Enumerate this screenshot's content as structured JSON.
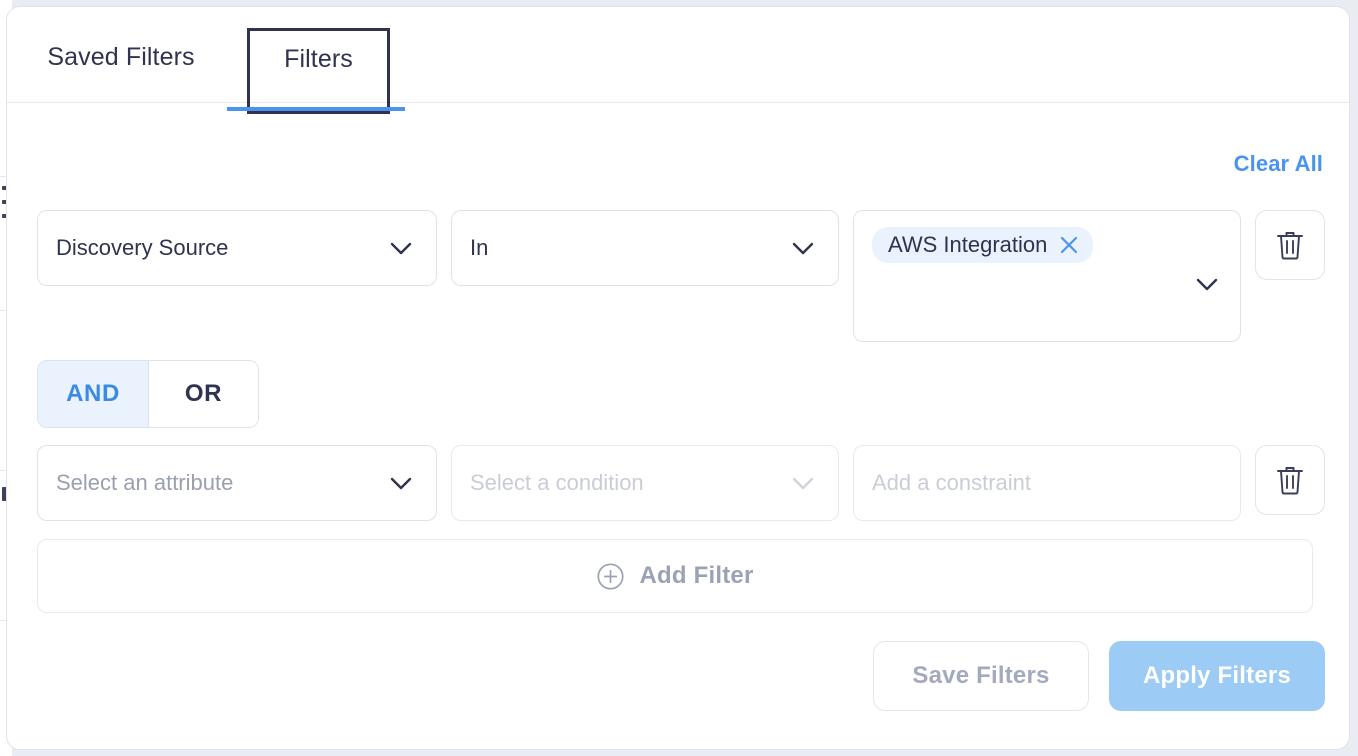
{
  "panel": {
    "tabs": [
      {
        "id": "saved-filters",
        "label": "Saved Filters",
        "selected": false
      },
      {
        "id": "filters",
        "label": "Filters",
        "selected": true,
        "focused": true
      }
    ],
    "clear_all_label": "Clear All",
    "accent_color": "#4a94ef",
    "text_color": "#2f3350",
    "placeholder_color": "#9aa0ae",
    "disabled_color": "#c9cdd6"
  },
  "filter_rows": [
    {
      "attribute": {
        "value": "Discovery Source",
        "is_placeholder": false,
        "icon": "chevron-down-icon"
      },
      "condition": {
        "value": "In",
        "is_placeholder": false,
        "icon": "chevron-down-icon"
      },
      "constraint": {
        "chips": [
          {
            "label": "AWS Integration",
            "remove_icon": "close-icon"
          }
        ],
        "icon": "chevron-down-icon"
      },
      "delete": {
        "icon": "trash-icon"
      }
    },
    {
      "attribute": {
        "value": "Select an attribute",
        "is_placeholder": true,
        "icon": "chevron-down-icon"
      },
      "condition": {
        "value": "Select a condition",
        "is_placeholder": true,
        "disabled": true,
        "icon": "chevron-down-icon"
      },
      "constraint": {
        "value": "Add a constraint",
        "is_placeholder": true,
        "disabled": true
      },
      "delete": {
        "icon": "trash-icon"
      }
    }
  ],
  "logic_toggle": {
    "options": [
      {
        "label": "AND",
        "selected": true
      },
      {
        "label": "OR",
        "selected": false
      }
    ],
    "selected_bg": "#e9f2fd",
    "selected_fg": "#3b8ae6"
  },
  "add_filter": {
    "label": "Add Filter",
    "icon": "plus-circle-icon"
  },
  "footer": {
    "save_label": "Save Filters",
    "apply_label": "Apply Filters",
    "apply_bg": "#9ccbf5"
  }
}
